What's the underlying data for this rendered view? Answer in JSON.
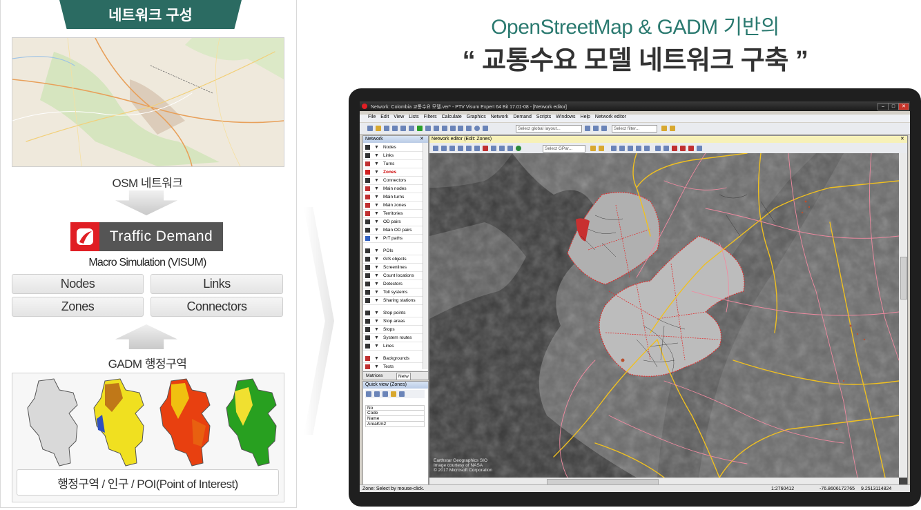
{
  "left_panel": {
    "header": "네트워크 구성",
    "osm_caption": "OSM 네트워크",
    "logo_text": "Traffic Demand",
    "macro_caption": "Macro Simulation (VISUM)",
    "features": [
      "Nodes",
      "Links",
      "Zones",
      "Connectors"
    ],
    "gadm_caption": "GADM 행정구역",
    "gadm_label": "행정구역 / 인구 / POI(Point of Interest)"
  },
  "titles": {
    "line1": "OpenStreetMap & GADM 기반의",
    "line2": "“ 교통수요 모델 네트워크 구축 ”"
  },
  "app": {
    "window_title": "Network: Colombia 교통수요 모델.ver* - PTV Visum Expert 64 Bit 17.01-08 - [Network editor]",
    "window_buttons": [
      "–",
      "□",
      "✕"
    ],
    "menu": [
      "File",
      "Edit",
      "View",
      "Lists",
      "Filters",
      "Calculate",
      "Graphics",
      "Network",
      "Demand",
      "Scripts",
      "Windows",
      "Help",
      "Network editor"
    ],
    "layout_select": "Select global layout...",
    "filter_select": "Select filter...",
    "network_panel_title": "Network",
    "network_items": [
      {
        "label": "Nodes",
        "icon": "nodes-icon",
        "color": "#333333"
      },
      {
        "label": "Links",
        "icon": "links-icon",
        "color": "#333333"
      },
      {
        "label": "Turns",
        "icon": "turns-icon",
        "color": "#c03030"
      },
      {
        "label": "Zones",
        "icon": "zones-icon",
        "color": "#d02020",
        "active": true
      },
      {
        "label": "Connectors",
        "icon": "connectors-icon",
        "color": "#333333"
      },
      {
        "label": "Main nodes",
        "icon": "main-nodes-icon",
        "color": "#c03030"
      },
      {
        "label": "Main turns",
        "icon": "main-turns-icon",
        "color": "#c03030"
      },
      {
        "label": "Main zones",
        "icon": "main-zones-icon",
        "color": "#c03030"
      },
      {
        "label": "Territories",
        "icon": "territories-icon",
        "color": "#c03030"
      },
      {
        "label": "OD pairs",
        "icon": "od-pairs-icon",
        "color": "#333333"
      },
      {
        "label": "Main OD pairs",
        "icon": "main-od-pairs-icon",
        "color": "#333333"
      },
      {
        "label": "PrT paths",
        "icon": "prt-paths-icon",
        "color": "#3060c0"
      },
      {
        "label": "POIs",
        "icon": "pois-icon",
        "color": "#333333"
      },
      {
        "label": "GIS objects",
        "icon": "gis-objects-icon",
        "color": "#333333"
      },
      {
        "label": "Screenlines",
        "icon": "screenlines-icon",
        "color": "#333333"
      },
      {
        "label": "Count locations",
        "icon": "count-locations-icon",
        "color": "#333333"
      },
      {
        "label": "Detectors",
        "icon": "detectors-icon",
        "color": "#333333"
      },
      {
        "label": "Toll systems",
        "icon": "toll-systems-icon",
        "color": "#333333"
      },
      {
        "label": "Sharing stations",
        "icon": "sharing-stations-icon",
        "color": "#333333"
      },
      {
        "label": "Stop points",
        "icon": "stop-points-icon",
        "color": "#333333"
      },
      {
        "label": "Stop areas",
        "icon": "stop-areas-icon",
        "color": "#333333"
      },
      {
        "label": "Stops",
        "icon": "stops-icon",
        "color": "#333333"
      },
      {
        "label": "System routes",
        "icon": "system-routes-icon",
        "color": "#333333"
      },
      {
        "label": "Lines",
        "icon": "lines-icon",
        "color": "#333333"
      },
      {
        "label": "Backgrounds",
        "icon": "backgrounds-icon",
        "color": "#c03030"
      },
      {
        "label": "Texts",
        "icon": "texts-icon",
        "color": "#c03030"
      }
    ],
    "panel_tabs": [
      "Matrices",
      "Netw"
    ],
    "quick_view_title": "Quick view (Zones)",
    "quick_view_rows": [
      "No",
      "Code",
      "Name",
      "AreaKm2"
    ],
    "editor_title": "Network editor (Edit: Zones)",
    "editor_select": "Select GPar...",
    "attribution": [
      "Earthstar Geographics  SIO",
      "Image courtesy of NASA",
      "© 2017 Microsoft Corporation"
    ],
    "status_text": "Zone: Select by mouse-click.",
    "status_scale": "1:2760412",
    "status_x": "-76.8606172765",
    "status_y": "9.2513114824"
  },
  "colors": {
    "accent_teal": "#2b6b62",
    "title_teal": "#2b7a70",
    "logo_red": "#e01e24",
    "zone_outline": "#e03030",
    "road_yellow": "#f0c020",
    "road_pink": "#f08aa0"
  }
}
